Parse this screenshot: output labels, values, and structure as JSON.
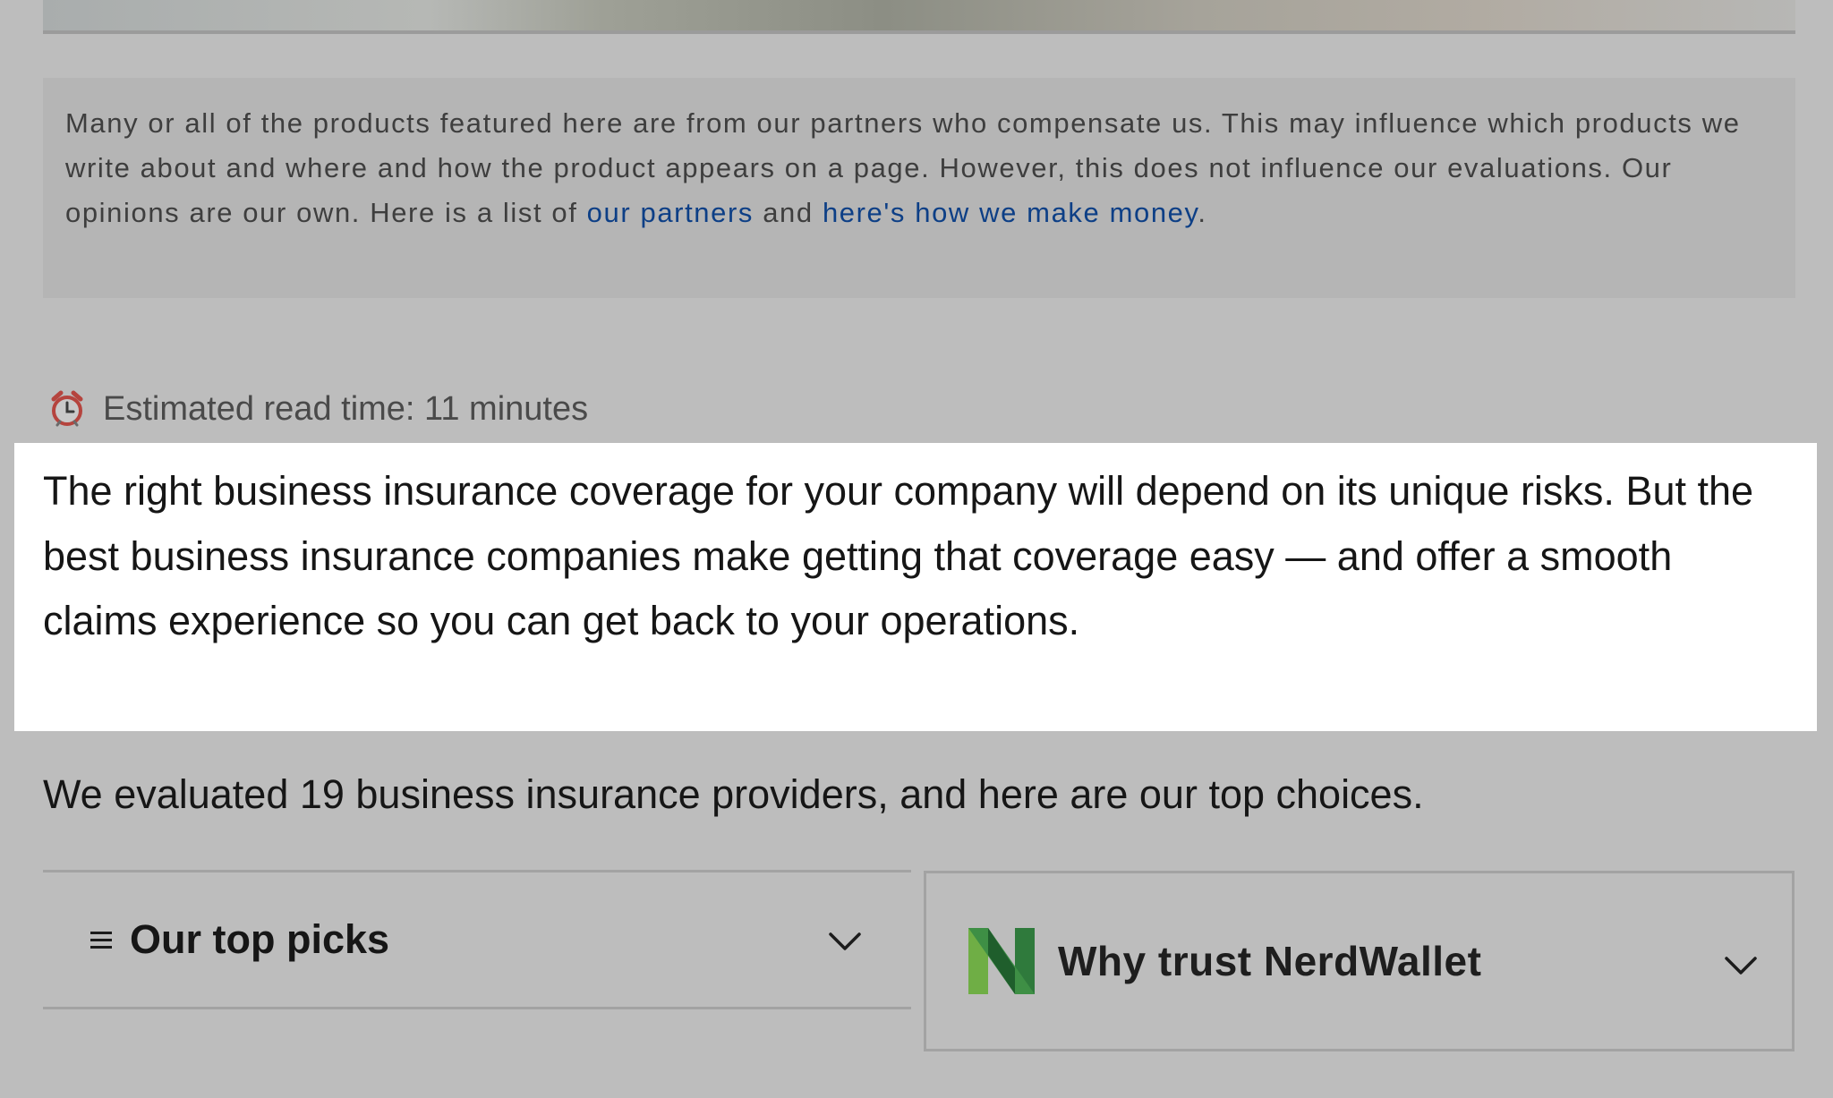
{
  "disclosure": {
    "text_1": "Many or all of the products featured here are from our partners who compensate us. This may influence which products we write about and where and how the product appears on a page. However, this does not influence our evaluations. Our opinions are our own. Here is a list of ",
    "link_partners": "our partners",
    "text_2": " and ",
    "link_money": "here's how we make money",
    "text_3": "."
  },
  "read_time": {
    "icon": "alarm-clock-icon",
    "text": "Estimated read time: 11 minutes"
  },
  "intro": {
    "highlighted_text": "The right business insurance coverage for your company will depend on its unique risks. But the best business insurance companies make getting that coverage easy — and offer a smooth claims experience so you can get back to your operations.",
    "summary_text": "We evaluated 19 business insurance providers, and here are our top choices."
  },
  "accordions": {
    "top_picks": {
      "label": "Our top picks",
      "icon": "menu-lines-icon",
      "toggle_icon": "chevron-down-icon"
    },
    "trust": {
      "label": "Why trust NerdWallet",
      "icon": "nerdwallet-logo-icon",
      "toggle_icon": "chevron-down-icon"
    }
  },
  "colors": {
    "overlay_background": "#bdbdbd",
    "link": "#0d3f86",
    "highlight_background": "#ffffff",
    "brand_green_dark": "#2f7a3c",
    "brand_green_light": "#7cbf4a"
  }
}
